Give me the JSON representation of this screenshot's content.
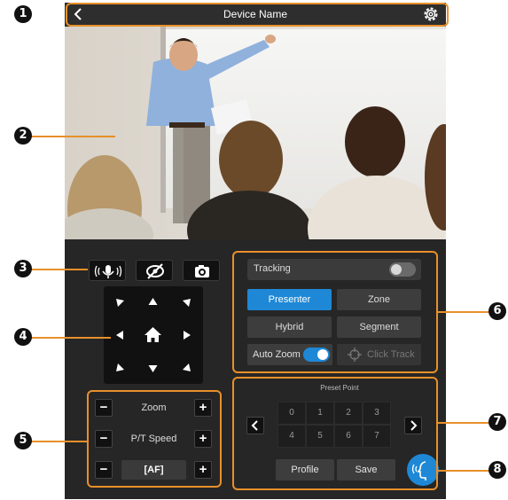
{
  "header": {
    "title": "Device Name"
  },
  "icons": {
    "back": "chevron-left-icon",
    "settings": "gear-icon",
    "voice": "microphone-voice-icon",
    "hide": "eye-off-icon",
    "snapshot": "camera-icon",
    "home": "home-icon",
    "talk": "voice-tracking-icon",
    "target": "crosshair-icon"
  },
  "lens": {
    "zoom_label": "Zoom",
    "pt_speed_label": "P/T Speed",
    "af_label": "[AF]",
    "minus": "−",
    "plus": "+"
  },
  "tracking": {
    "label": "Tracking",
    "enabled": false,
    "modes": [
      {
        "label": "Presenter",
        "active": true
      },
      {
        "label": "Zone",
        "active": false
      },
      {
        "label": "Hybrid",
        "active": false
      },
      {
        "label": "Segment",
        "active": false
      }
    ],
    "auto_zoom_label": "Auto Zoom",
    "auto_zoom_enabled": true,
    "click_track_label": "Click Track"
  },
  "preset": {
    "title": "Preset Point",
    "points": [
      "0",
      "1",
      "2",
      "3",
      "4",
      "5",
      "6",
      "7"
    ],
    "profile_label": "Profile",
    "save_label": "Save"
  },
  "callouts": [
    "1",
    "2",
    "3",
    "4",
    "5",
    "6",
    "7",
    "8"
  ],
  "colors": {
    "accent": "#1e88d6",
    "highlight": "#e8902a",
    "panel": "#262626"
  }
}
